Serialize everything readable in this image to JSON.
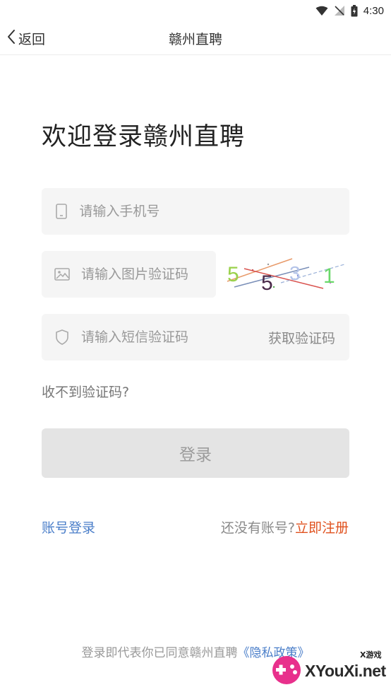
{
  "status_bar": {
    "time": "4:30",
    "icons": [
      "wifi-icon",
      "no-signal-icon",
      "battery-icon"
    ]
  },
  "nav": {
    "back_label": "返回",
    "title": "赣州直聘"
  },
  "welcome": "欢迎登录赣州直聘",
  "form": {
    "phone_placeholder": "请输入手机号",
    "image_code_placeholder": "请输入图片验证码",
    "sms_code_placeholder": "请输入短信验证码",
    "get_code_label": "获取验证码",
    "captcha_chars": [
      "5",
      "5",
      "3",
      "1"
    ]
  },
  "no_code_link": "收不到验证码?",
  "login_button": "登录",
  "account_login_link": "账号登录",
  "register": {
    "prompt": "还没有账号?",
    "link": "立即注册"
  },
  "agreement": {
    "text": "登录即代表你已同意赣州直聘",
    "policy": "《隐私政策》"
  },
  "watermark": {
    "text": "XYouXi.net",
    "small": "X游戏"
  },
  "colors": {
    "link_blue": "#4a7ec9",
    "register_red": "#e0521f",
    "button_disabled": "#e4e4e4",
    "field_bg": "#f5f5f5"
  }
}
